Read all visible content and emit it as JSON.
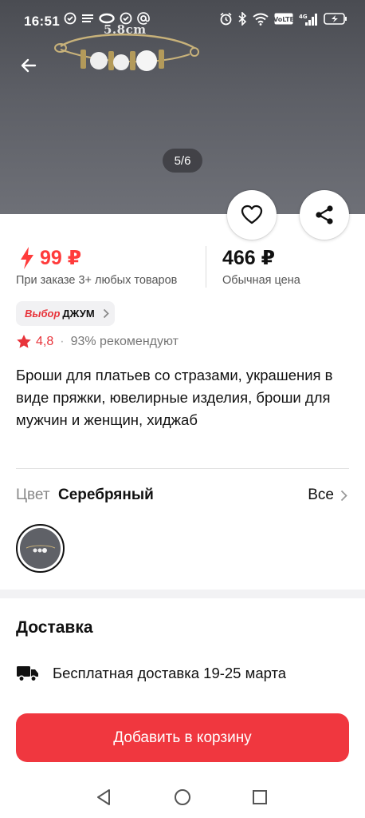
{
  "status_bar": {
    "time": "16:51",
    "icons": [
      "check-circle-icon",
      "lines-icon",
      "ring-icon",
      "check-circle-icon",
      "at-icon",
      "alarm-icon",
      "bluetooth-icon",
      "wifi-icon",
      "volte-icon",
      "signal-4g-icon",
      "battery-charging-icon"
    ]
  },
  "hero": {
    "image_label": "5.8cm",
    "counter": "5/6"
  },
  "price": {
    "promo_value": "99 ₽",
    "promo_note": "При заказе 3+ любых товаров",
    "regular_value": "466 ₽",
    "regular_note": "Обычная цена"
  },
  "badge": {
    "part1": "Выбор",
    "part2": "ДЖУМ"
  },
  "rating": {
    "value": "4,8",
    "separator": "·",
    "recommend": "93% рекомендуют"
  },
  "product": {
    "title": "Броши для платьев со стразами, украшения в виде пряжки, ювелирные изделия, броши для мужчин и женщин, хиджаб"
  },
  "color": {
    "label": "Цвет",
    "value": "Серебряный",
    "all_link": "Все"
  },
  "delivery": {
    "title": "Доставка",
    "text": "Бесплатная доставка 19-25 марта"
  },
  "cart_button": "Добавить в корзину",
  "colors": {
    "accent": "#f0373f",
    "price_red": "#ff3b3b",
    "muted": "#888888"
  }
}
